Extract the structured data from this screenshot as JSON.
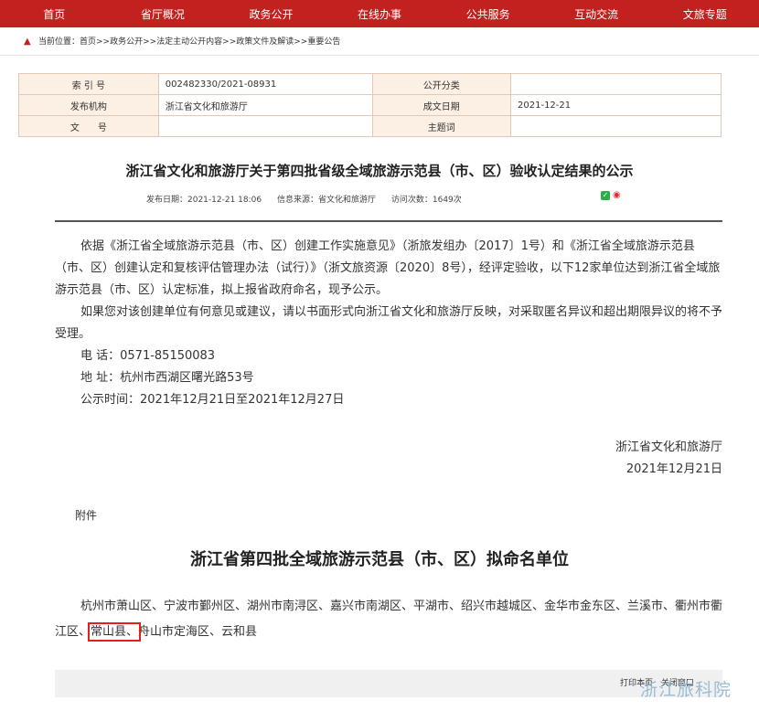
{
  "nav": [
    "首页",
    "省厅概况",
    "政务公开",
    "在线办事",
    "公共服务",
    "互动交流",
    "文旅专题"
  ],
  "breadcrumb": "当前位置：首页>>政务公开>>法定主动公开内容>>政策文件及解读>>重要公告",
  "meta": {
    "index_label": "索 引 号",
    "index_value": "002482330/2021-08931",
    "category_label": "公开分类",
    "category_value": "",
    "publisher_label": "发布机构",
    "publisher_value": "浙江省文化和旅游厅",
    "date_label": "成文日期",
    "date_value": "2021-12-21",
    "docno_label": "文　　号",
    "docno_value": "",
    "topic_label": "主题词",
    "topic_value": ""
  },
  "article": {
    "title": "浙江省文化和旅游厅关于第四批省级全域旅游示范县（市、区）验收认定结果的公示",
    "publish_date": "发布日期：2021-12-21 18:06",
    "source": "信息来源：省文化和旅游厅",
    "views": "访问次数：1649次",
    "para1": "依据《浙江省全域旅游示范县（市、区）创建工作实施意见》（浙旅发组办〔2017〕1号）和《浙江省全域旅游示范县（市、区）创建认定和复核评估管理办法（试行）》（浙文旅资源〔2020〕8号），经评定验收，以下12家单位达到浙江省全域旅游示范县（市、区）认定标准，拟上报省政府命名，现予公示。",
    "para2": "如果您对该创建单位有何意见或建议，请以书面形式向浙江省文化和旅游厅反映，对采取匿名异议和超出期限异议的将不予受理。",
    "phone": "电  话：0571-85150083",
    "address": "地  址：杭州市西湖区曙光路53号",
    "period": "公示时间：2021年12月21日至2021年12月27日",
    "signer": "浙江省文化和旅游厅",
    "sign_date": "2021年12月21日",
    "attachment": "附件",
    "subtitle": "浙江省第四批全域旅游示范县（市、区）拟命名单位",
    "list_before": "杭州市萧山区、宁波市鄞州区、湖州市南浔区、嘉兴市南湖区、平湖市、绍兴市越城区、金华市金东区、兰溪市、衢州市衢江区、",
    "list_highlight": "常山县、",
    "list_after": "舟山市定海区、云和县"
  },
  "footer": {
    "print": "打印本页",
    "close": "关闭窗口"
  },
  "watermark": "浙江旅科院"
}
